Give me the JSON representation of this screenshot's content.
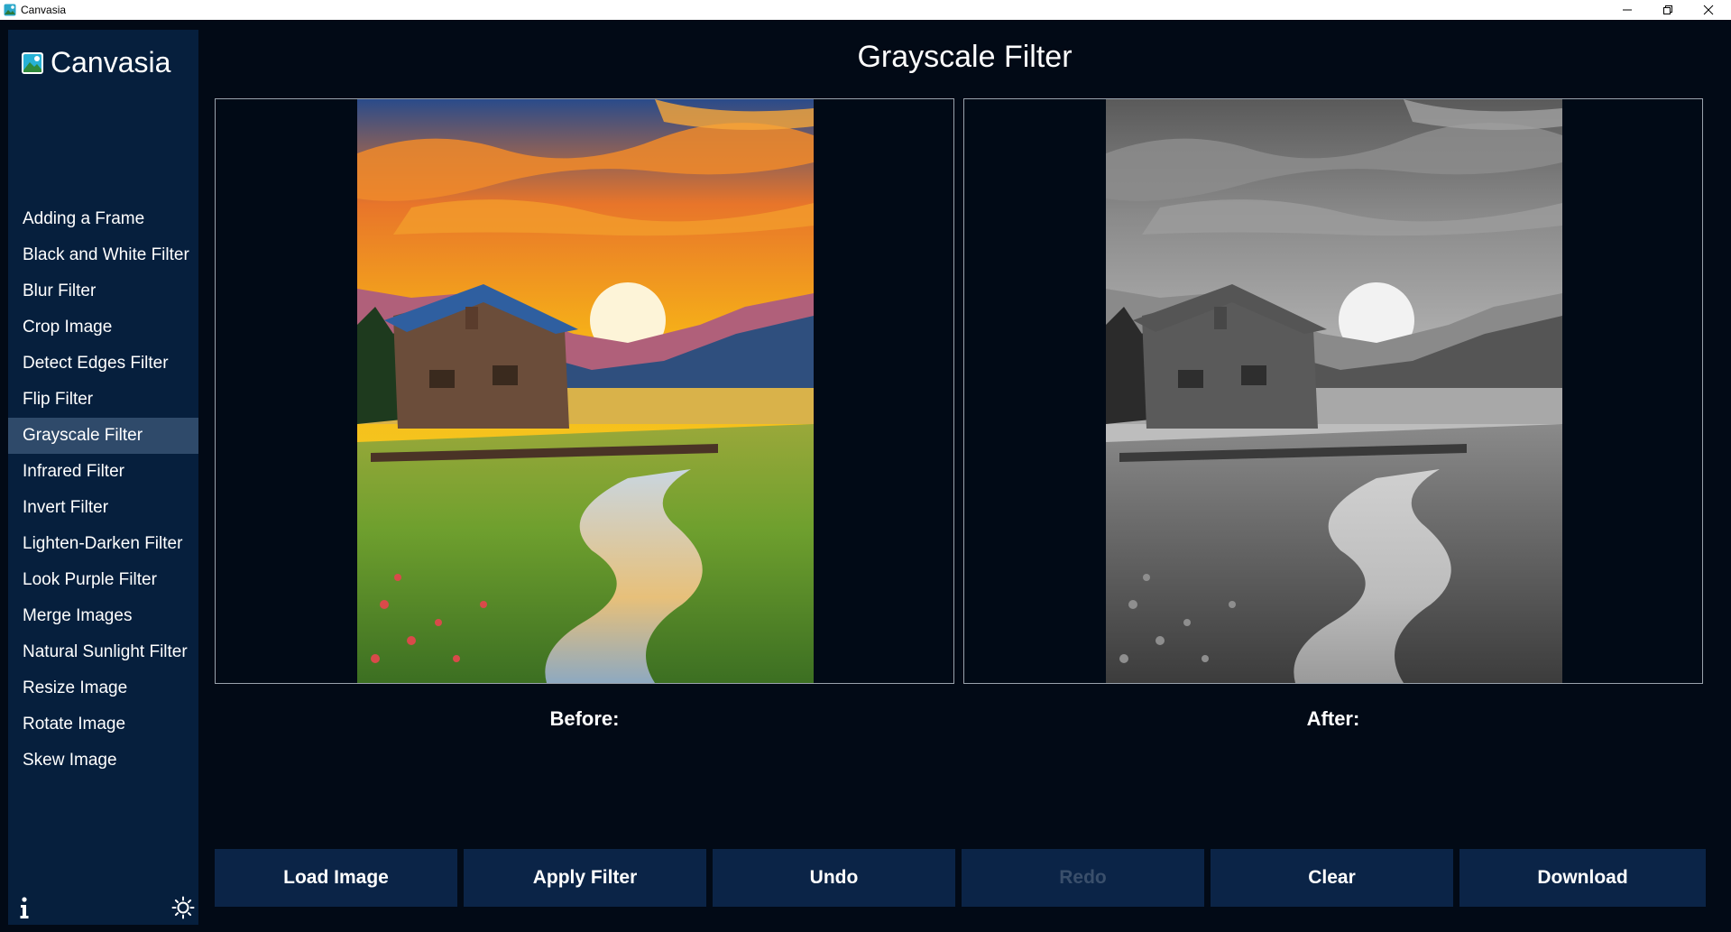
{
  "window": {
    "title": "Canvasia"
  },
  "brand": {
    "name": "Canvasia"
  },
  "sidebar": {
    "items": [
      {
        "label": "Adding a Frame"
      },
      {
        "label": "Black and White Filter"
      },
      {
        "label": "Blur Filter"
      },
      {
        "label": "Crop Image"
      },
      {
        "label": "Detect Edges Filter"
      },
      {
        "label": "Flip Filter"
      },
      {
        "label": "Grayscale Filter",
        "active": true
      },
      {
        "label": "Infrared Filter"
      },
      {
        "label": "Invert Filter"
      },
      {
        "label": "Lighten-Darken Filter"
      },
      {
        "label": "Look Purple Filter"
      },
      {
        "label": "Merge Images"
      },
      {
        "label": "Natural Sunlight Filter"
      },
      {
        "label": "Resize Image"
      },
      {
        "label": "Rotate Image"
      },
      {
        "label": "Skew Image"
      }
    ],
    "bottom_icons": [
      "info-icon",
      "sun-theme-icon"
    ]
  },
  "main": {
    "title": "Grayscale Filter",
    "before_label": "Before:",
    "after_label": "After:"
  },
  "actions": {
    "load": "Load Image",
    "apply": "Apply Filter",
    "undo": "Undo",
    "redo": "Redo",
    "clear": "Clear",
    "download": "Download"
  },
  "colors": {
    "background": "#020a16",
    "sidebar": "#061f3d",
    "sidebar_active": "#2f4a6a",
    "button": "#0b2447",
    "button_disabled_text": "#3a4f6b",
    "panel_border": "#9aa3ad"
  }
}
